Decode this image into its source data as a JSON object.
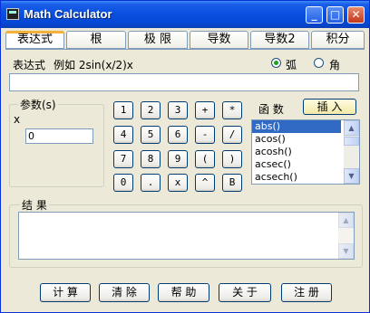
{
  "window": {
    "title": "Math Calculator"
  },
  "titlebar_buttons": {
    "minimize": "_",
    "maximize": "□",
    "close": "✕"
  },
  "tabs": [
    {
      "label": "表达式"
    },
    {
      "label": "根"
    },
    {
      "label": "极 限"
    },
    {
      "label": "导数"
    },
    {
      "label": "导数2"
    },
    {
      "label": "积分"
    }
  ],
  "expression": {
    "label": "表达式",
    "example": "例如 2sin(x/2)x",
    "value": ""
  },
  "angle_mode": {
    "radian": "弧",
    "degree": "角",
    "selected": "radian"
  },
  "params": {
    "title": "参数(s)",
    "var_name": "x",
    "value": "0"
  },
  "keypad": [
    [
      "1",
      "2",
      "3",
      "+",
      "*"
    ],
    [
      "4",
      "5",
      "6",
      "-",
      "/"
    ],
    [
      "7",
      "8",
      "9",
      "(",
      ")"
    ],
    [
      "0",
      ".",
      "x",
      "^",
      "B"
    ]
  ],
  "functions": {
    "label": "函 数",
    "insert_label": "插 入",
    "items": [
      "abs()",
      "acos()",
      "acosh()",
      "acsec()",
      "acsech()"
    ],
    "selected_index": 0
  },
  "result": {
    "title": "结 果",
    "value": ""
  },
  "buttons": {
    "calculate": "计 算",
    "clear": "清 除",
    "help": "帮 助",
    "about": "关 于",
    "register": "注 册"
  },
  "icons": {
    "app": "calculator-app-icon",
    "scroll_up": "scroll-up-arrow-icon",
    "scroll_down": "scroll-down-arrow-icon"
  },
  "colors": {
    "titlebar": "#0a50e0",
    "selection": "#316ac5",
    "window_bg": "#ece9d8",
    "active_tab_accent": "#f1b13a"
  }
}
